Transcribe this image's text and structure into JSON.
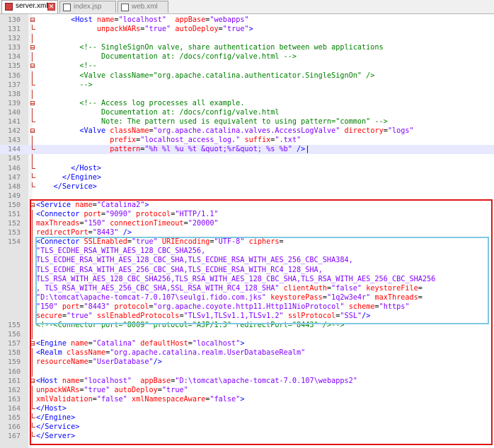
{
  "tabs": [
    {
      "label": "server.xml",
      "active": true
    },
    {
      "label": "index.jsp",
      "active": false
    },
    {
      "label": "web.xml",
      "active": false
    }
  ],
  "colors": {
    "tag": "#0000ff",
    "attribute": "#ff0000",
    "value": "#8000ff",
    "comment": "#008000",
    "highlight_red": "#e01414",
    "highlight_blue": "#7ec8e3"
  },
  "lines": [
    {
      "num": "130",
      "fold": "mark",
      "segments": [
        [
          "p",
          "        "
        ],
        [
          "t",
          "<Host "
        ],
        [
          "a",
          "name"
        ],
        [
          "p",
          "="
        ],
        [
          "v",
          "\"localhost\""
        ],
        [
          "p",
          "  "
        ],
        [
          "a",
          "appBase"
        ],
        [
          "p",
          "="
        ],
        [
          "v",
          "\"webapps\""
        ]
      ]
    },
    {
      "num": "131",
      "fold": "end",
      "segments": [
        [
          "p",
          "              "
        ],
        [
          "a",
          "unpackWARs"
        ],
        [
          "p",
          "="
        ],
        [
          "v",
          "\"true\""
        ],
        [
          "p",
          " "
        ],
        [
          "a",
          "autoDeploy"
        ],
        [
          "p",
          "="
        ],
        [
          "v",
          "\"true\""
        ],
        [
          "t",
          ">"
        ]
      ]
    },
    {
      "num": "132",
      "fold": "line",
      "segments": [
        [
          "p",
          ""
        ]
      ]
    },
    {
      "num": "133",
      "fold": "mark",
      "segments": [
        [
          "p",
          "          "
        ],
        [
          "c",
          "<!-- SingleSignOn valve, share authentication between web applications"
        ]
      ]
    },
    {
      "num": "134",
      "fold": "line",
      "segments": [
        [
          "c",
          "               Documentation at: /docs/config/valve.html -->"
        ]
      ]
    },
    {
      "num": "135",
      "fold": "mark",
      "segments": [
        [
          "p",
          "          "
        ],
        [
          "c",
          "<!--"
        ]
      ]
    },
    {
      "num": "136",
      "fold": "line",
      "segments": [
        [
          "p",
          "          "
        ],
        [
          "c",
          "<Valve className=\"org.apache.catalina.authenticator.SingleSignOn\" />"
        ]
      ]
    },
    {
      "num": "137",
      "fold": "end",
      "segments": [
        [
          "p",
          "          "
        ],
        [
          "c",
          "-->"
        ]
      ]
    },
    {
      "num": "138",
      "fold": "line",
      "segments": [
        [
          "p",
          ""
        ]
      ]
    },
    {
      "num": "139",
      "fold": "mark",
      "segments": [
        [
          "p",
          "          "
        ],
        [
          "c",
          "<!-- Access log processes all example."
        ]
      ]
    },
    {
      "num": "140",
      "fold": "line",
      "segments": [
        [
          "c",
          "               Documentation at: /docs/config/valve.html"
        ]
      ]
    },
    {
      "num": "141",
      "fold": "end",
      "segments": [
        [
          "c",
          "               Note: The pattern used is equivalent to using pattern=\"common\" -->"
        ]
      ]
    },
    {
      "num": "142",
      "fold": "mark",
      "segments": [
        [
          "p",
          "          "
        ],
        [
          "t",
          "<Valve "
        ],
        [
          "a",
          "className"
        ],
        [
          "p",
          "="
        ],
        [
          "v",
          "\"org.apache.catalina.valves.AccessLogValve\""
        ],
        [
          "p",
          " "
        ],
        [
          "a",
          "directory"
        ],
        [
          "p",
          "="
        ],
        [
          "v",
          "\"logs\""
        ]
      ]
    },
    {
      "num": "143",
      "fold": "line",
      "segments": [
        [
          "p",
          "                 "
        ],
        [
          "a",
          "prefix"
        ],
        [
          "p",
          "="
        ],
        [
          "v",
          "\"localhost_access_log.\""
        ],
        [
          "p",
          " "
        ],
        [
          "a",
          "suffix"
        ],
        [
          "p",
          "="
        ],
        [
          "v",
          "\".txt\""
        ]
      ]
    },
    {
      "num": "144",
      "fold": "end",
      "hl": true,
      "segments": [
        [
          "p",
          "                 "
        ],
        [
          "a",
          "pattern"
        ],
        [
          "p",
          "="
        ],
        [
          "v",
          "\"%h %l %u %t &quot;%r&quot; %s %b\""
        ],
        [
          "p",
          " "
        ],
        [
          "t",
          "/>"
        ],
        [
          "p",
          "|"
        ]
      ]
    },
    {
      "num": "145",
      "fold": "line",
      "segments": [
        [
          "p",
          ""
        ]
      ]
    },
    {
      "num": "146",
      "fold": "end",
      "segments": [
        [
          "p",
          "        "
        ],
        [
          "t",
          "</Host>"
        ]
      ]
    },
    {
      "num": "147",
      "fold": "end",
      "segments": [
        [
          "p",
          "      "
        ],
        [
          "t",
          "</Engine>"
        ]
      ]
    },
    {
      "num": "148",
      "fold": "end",
      "segments": [
        [
          "p",
          "    "
        ],
        [
          "t",
          "</Service>"
        ]
      ]
    },
    {
      "num": "149",
      "fold": "none",
      "segments": [
        [
          "p",
          ""
        ]
      ]
    },
    {
      "num": "150",
      "fold": "mark",
      "segments": [
        [
          "t",
          "<Service "
        ],
        [
          "a",
          "name"
        ],
        [
          "p",
          "="
        ],
        [
          "v",
          "\"Catalina2\""
        ],
        [
          "t",
          ">"
        ]
      ]
    },
    {
      "num": "151",
      "fold": "line",
      "segments": [
        [
          "t",
          "<Connector "
        ],
        [
          "a",
          "port"
        ],
        [
          "p",
          "="
        ],
        [
          "v",
          "\"9090\""
        ],
        [
          "p",
          " "
        ],
        [
          "a",
          "protocol"
        ],
        [
          "p",
          "="
        ],
        [
          "v",
          "\"HTTP/1.1\""
        ]
      ]
    },
    {
      "num": "152",
      "fold": "line",
      "segments": [
        [
          "a",
          "maxThreads"
        ],
        [
          "p",
          "="
        ],
        [
          "v",
          "\"150\""
        ],
        [
          "p",
          " "
        ],
        [
          "a",
          "connectionTimeout"
        ],
        [
          "p",
          "="
        ],
        [
          "v",
          "\"20000\""
        ]
      ]
    },
    {
      "num": "153",
      "fold": "line",
      "segments": [
        [
          "a",
          "redirectPort"
        ],
        [
          "p",
          "="
        ],
        [
          "v",
          "\"8443\""
        ],
        [
          "p",
          " "
        ],
        [
          "t",
          "/>"
        ]
      ]
    },
    {
      "num": "154",
      "fold": "line",
      "segments": [
        [
          "t",
          "<Connector "
        ],
        [
          "a",
          "SSLEnabled"
        ],
        [
          "p",
          "="
        ],
        [
          "v",
          "\"true\""
        ],
        [
          "p",
          " "
        ],
        [
          "a",
          "URIEncoding"
        ],
        [
          "p",
          "="
        ],
        [
          "v",
          "\"UTF-8\""
        ],
        [
          "p",
          " "
        ],
        [
          "a",
          "ciphers"
        ],
        [
          "p",
          "="
        ]
      ]
    },
    {
      "num": "",
      "fold": "line",
      "segments": [
        [
          "v",
          "\"TLS_ECDHE_RSA_WITH_AES_128_CBC_SHA256,"
        ]
      ]
    },
    {
      "num": "",
      "fold": "line",
      "segments": [
        [
          "v",
          "TLS_ECDHE_RSA_WITH_AES_128_CBC_SHA,TLS_ECDHE_RSA_WITH_AES_256_CBC_SHA384,"
        ]
      ]
    },
    {
      "num": "",
      "fold": "line",
      "segments": [
        [
          "v",
          "TLS_ECDHE_RSA_WITH_AES_256_CBC_SHA,TLS_ECDHE_RSA_WITH_RC4_128_SHA,"
        ]
      ]
    },
    {
      "num": "",
      "fold": "line",
      "segments": [
        [
          "v",
          "TLS_RSA_WITH_AES_128_CBC_SHA256,TLS_RSA_WITH_AES_128_CBC_SHA,TLS_RSA_WITH_AES_256_CBC_SHA256"
        ]
      ]
    },
    {
      "num": "",
      "fold": "line",
      "segments": [
        [
          "v",
          ", TLS_RSA_WITH_AES_256_CBC_SHA,SSL_RSA_WITH_RC4_128_SHA\""
        ],
        [
          "p",
          " "
        ],
        [
          "a",
          "clientAuth"
        ],
        [
          "p",
          "="
        ],
        [
          "v",
          "\"false\""
        ],
        [
          "p",
          " "
        ],
        [
          "a",
          "keystoreFile"
        ],
        [
          "p",
          "="
        ]
      ]
    },
    {
      "num": "",
      "fold": "line",
      "segments": [
        [
          "v",
          "\"D:\\tomcat\\apache-tomcat-7.0.107\\seulgi.fido.com.jks\""
        ],
        [
          "p",
          " "
        ],
        [
          "a",
          "keystorePass"
        ],
        [
          "p",
          "="
        ],
        [
          "v",
          "\"1q2w3e4r\""
        ],
        [
          "p",
          " "
        ],
        [
          "a",
          "maxThreads"
        ],
        [
          "p",
          "="
        ]
      ]
    },
    {
      "num": "",
      "fold": "line",
      "segments": [
        [
          "v",
          "\"150\""
        ],
        [
          "p",
          " "
        ],
        [
          "a",
          "port"
        ],
        [
          "p",
          "="
        ],
        [
          "v",
          "\"8443\""
        ],
        [
          "p",
          " "
        ],
        [
          "a",
          "protocol"
        ],
        [
          "p",
          "="
        ],
        [
          "v",
          "\"org.apache.coyote.http11.Http11NioProtocol\""
        ],
        [
          "p",
          " "
        ],
        [
          "a",
          "scheme"
        ],
        [
          "p",
          "="
        ],
        [
          "v",
          "\"https\""
        ]
      ]
    },
    {
      "num": "",
      "fold": "line",
      "segments": [
        [
          "a",
          "secure"
        ],
        [
          "p",
          "="
        ],
        [
          "v",
          "\"true\""
        ],
        [
          "p",
          " "
        ],
        [
          "a",
          "sslEnabledProtocols"
        ],
        [
          "p",
          "="
        ],
        [
          "v",
          "\"TLSv1,TLSv1.1,TLSv1.2\""
        ],
        [
          "p",
          " "
        ],
        [
          "a",
          "sslProtocol"
        ],
        [
          "p",
          "="
        ],
        [
          "v",
          "\"SSL\""
        ],
        [
          "t",
          "/>"
        ]
      ]
    },
    {
      "num": "155",
      "fold": "line",
      "segments": [
        [
          "c",
          "<!--<Connector port=\"8009\" protocol=\"AJP/1.3\" redirectPort=\"8443\" />-->"
        ]
      ]
    },
    {
      "num": "156",
      "fold": "line",
      "segments": [
        [
          "p",
          ""
        ]
      ]
    },
    {
      "num": "157",
      "fold": "mark",
      "segments": [
        [
          "t",
          "<Engine "
        ],
        [
          "a",
          "name"
        ],
        [
          "p",
          "="
        ],
        [
          "v",
          "\"Catalina\""
        ],
        [
          "p",
          " "
        ],
        [
          "a",
          "defaultHost"
        ],
        [
          "p",
          "="
        ],
        [
          "v",
          "\"localhost\""
        ],
        [
          "t",
          ">"
        ]
      ]
    },
    {
      "num": "158",
      "fold": "line",
      "segments": [
        [
          "t",
          "<Realm "
        ],
        [
          "a",
          "className"
        ],
        [
          "p",
          "="
        ],
        [
          "v",
          "\"org.apache.catalina.realm.UserDatabaseRealm\""
        ]
      ]
    },
    {
      "num": "159",
      "fold": "line",
      "segments": [
        [
          "a",
          "resourceName"
        ],
        [
          "p",
          "="
        ],
        [
          "v",
          "\"UserDatabase\""
        ],
        [
          "t",
          "/>"
        ]
      ]
    },
    {
      "num": "160",
      "fold": "line",
      "segments": [
        [
          "p",
          ""
        ]
      ]
    },
    {
      "num": "161",
      "fold": "mark",
      "segments": [
        [
          "t",
          "<Host "
        ],
        [
          "a",
          "name"
        ],
        [
          "p",
          "="
        ],
        [
          "v",
          "\"localhost\""
        ],
        [
          "p",
          "  "
        ],
        [
          "a",
          "appBase"
        ],
        [
          "p",
          "="
        ],
        [
          "v",
          "\"D:\\tomcat\\apache-tomcat-7.0.107\\webapps2\""
        ]
      ]
    },
    {
      "num": "162",
      "fold": "line",
      "segments": [
        [
          "a",
          "unpackWARs"
        ],
        [
          "p",
          "="
        ],
        [
          "v",
          "\"true\""
        ],
        [
          "p",
          " "
        ],
        [
          "a",
          "autoDeploy"
        ],
        [
          "p",
          "="
        ],
        [
          "v",
          "\"true\""
        ]
      ]
    },
    {
      "num": "163",
      "fold": "line",
      "segments": [
        [
          "a",
          "xmlValidation"
        ],
        [
          "p",
          "="
        ],
        [
          "v",
          "\"false\""
        ],
        [
          "p",
          " "
        ],
        [
          "a",
          "xmlNamespaceAware"
        ],
        [
          "p",
          "="
        ],
        [
          "v",
          "\"false\""
        ],
        [
          "t",
          ">"
        ]
      ]
    },
    {
      "num": "164",
      "fold": "end",
      "segments": [
        [
          "t",
          "</Host>"
        ]
      ]
    },
    {
      "num": "165",
      "fold": "end",
      "segments": [
        [
          "t",
          "</Engine>"
        ]
      ]
    },
    {
      "num": "166",
      "fold": "end",
      "segments": [
        [
          "t",
          "</Service>"
        ]
      ]
    },
    {
      "num": "167",
      "fold": "end",
      "segments": [
        [
          "t",
          "</Server>"
        ]
      ]
    }
  ]
}
